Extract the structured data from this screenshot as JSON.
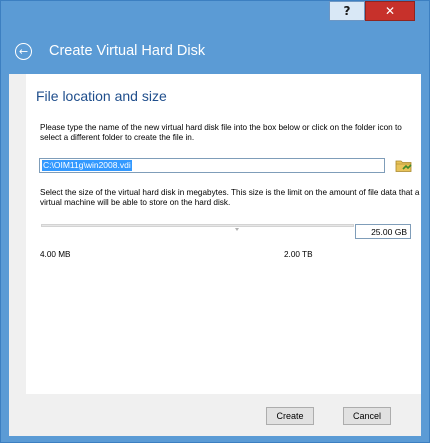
{
  "titlebar": {
    "help_label": "?",
    "close_label": "✕"
  },
  "header": {
    "title": "Create Virtual Hard Disk",
    "back_icon": "back-arrow-icon"
  },
  "page": {
    "section_title": "File location and size",
    "location_description": "Please type the name of the new virtual hard disk file into the box below or click on the folder icon to select a different folder to create the file in.",
    "file_path_value": "C:\\OIM11g\\win2008.vdi",
    "folder_icon": "folder-browse-icon",
    "size_description": "Select the size of the virtual hard disk in megabytes. This size is the limit on the amount of file data that a virtual machine will be able to store on the hard disk.",
    "size_value": "25.00 GB",
    "slider_fraction": 0.62,
    "min_size_label": "4.00 MB",
    "max_size_label": "2.00 TB"
  },
  "buttons": {
    "create_label": "Create",
    "cancel_label": "Cancel"
  },
  "colors": {
    "accent": "#5b9bd5",
    "section_title": "#1f4e8c",
    "selection": "#3399ff",
    "close": "#c7312b"
  }
}
